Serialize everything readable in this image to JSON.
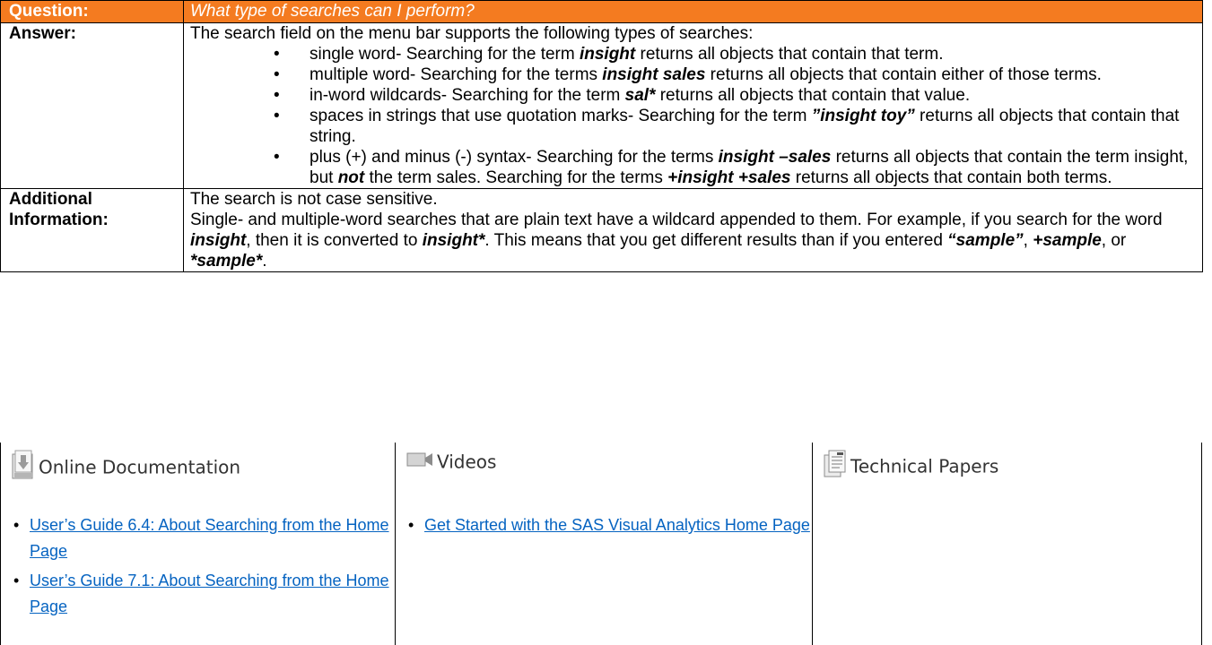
{
  "question": {
    "label": "Question:",
    "text": "What type of searches can I perform?"
  },
  "answer": {
    "label": "Answer:",
    "intro": "The search field on the menu bar supports the following types of searches:",
    "items": [
      {
        "pre": "single word- Searching for the term ",
        "term": "insight",
        "post": " returns all objects that contain that term."
      },
      {
        "pre": "multiple word- Searching for the terms ",
        "term": "insight sales",
        "post": " returns all objects that contain either of those terms."
      },
      {
        "pre": "in-word wildcards- Searching for the term ",
        "term": "sal*",
        "post": " returns all objects that contain that value."
      },
      {
        "pre": "spaces in strings that use quotation marks- Searching for the term ",
        "term": "”insight toy”",
        "post": " returns all objects that contain that string."
      }
    ],
    "plus_minus": {
      "pre": "plus (+) and minus (-) syntax- Searching for the terms ",
      "term1": "insight –sales",
      "mid1": " returns all objects that contain the term insight, but ",
      "not_word": "not",
      "mid2": " the term sales.  Searching for the terms ",
      "term2": "+insight +sales",
      "post": " returns all objects that contain both terms."
    }
  },
  "additional": {
    "label_line1": "Additional",
    "label_line2": "Information:",
    "line1": "The search is not case sensitive.",
    "p2_a": "Single- and multiple-word searches that are plain text have a wildcard appended to them.  For example, if you search for the word ",
    "p2_t1": "insight",
    "p2_b": ", then it is converted to ",
    "p2_t2": "insight*",
    "p2_c": ".  This means that you get different results than if you entered ",
    "p2_t3": "“sample”",
    "p2_d": ", ",
    "p2_t4": "+sample",
    "p2_e": ", or ",
    "p2_t5": "*sample*",
    "p2_f": "."
  },
  "resources": {
    "online_docs": {
      "title": "Online Documentation",
      "icon": "document-icon",
      "links": [
        "User’s Guide 6.4: About Searching from the Home Page",
        "User’s Guide 7.1: About Searching from the Home Page"
      ]
    },
    "videos": {
      "title": "Videos",
      "icon": "video-camera-icon",
      "links": [
        "Get Started with the SAS Visual Analytics Home Page"
      ]
    },
    "technical_papers": {
      "title": "Technical Papers",
      "icon": "papers-icon",
      "links": []
    }
  },
  "colors": {
    "header_bg": "#f47b20",
    "link": "#0563c1"
  }
}
